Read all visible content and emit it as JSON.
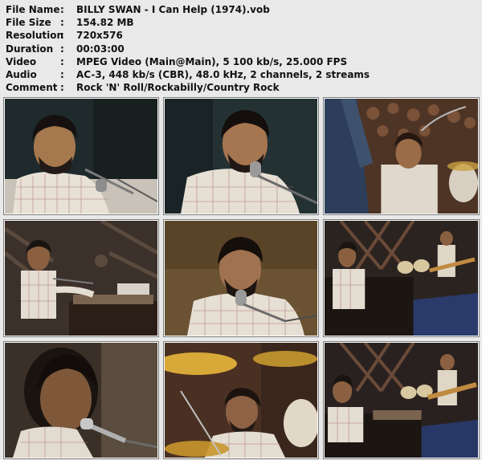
{
  "info": {
    "rows": [
      {
        "label": "File Name",
        "value": "BILLY SWAN - I Can Help (1974).vob"
      },
      {
        "label": "File Size",
        "value": "154.82 MB"
      },
      {
        "label": "Resolution",
        "value": "720x576"
      },
      {
        "label": "Duration",
        "value": "00:03:00"
      },
      {
        "label": "Video",
        "value": "MPEG Video (Main@Main), 5 100 kb/s, 25.000 FPS"
      },
      {
        "label": "Audio",
        "value": "AC-3, 448 kb/s (CBR), 48.0 kHz, 2 channels, 2 streams"
      },
      {
        "label": "Comment",
        "value": "Rock 'N' Roll/Rockabilly/Country Rock"
      }
    ],
    "separator": ":"
  },
  "thumbnails": [
    {
      "scene": "closeup-piano-singer-dark-bg",
      "bg": "#1f2a2c"
    },
    {
      "scene": "closeup-singer-microphone",
      "bg": "#243234"
    },
    {
      "scene": "audience-and-drummer",
      "bg": "#5a3a28"
    },
    {
      "scene": "stage-wide-piano-left",
      "bg": "#3a2f28"
    },
    {
      "scene": "medium-singer-microphone",
      "bg": "#5e4a2c"
    },
    {
      "scene": "band-wide-blue-floor",
      "bg": "#2c2420"
    },
    {
      "scene": "extreme-closeup-mic",
      "bg": "#3a3028"
    },
    {
      "scene": "drummer-cymbals",
      "bg": "#4a3020"
    },
    {
      "scene": "band-wide-guitarist",
      "bg": "#2a2220"
    }
  ]
}
